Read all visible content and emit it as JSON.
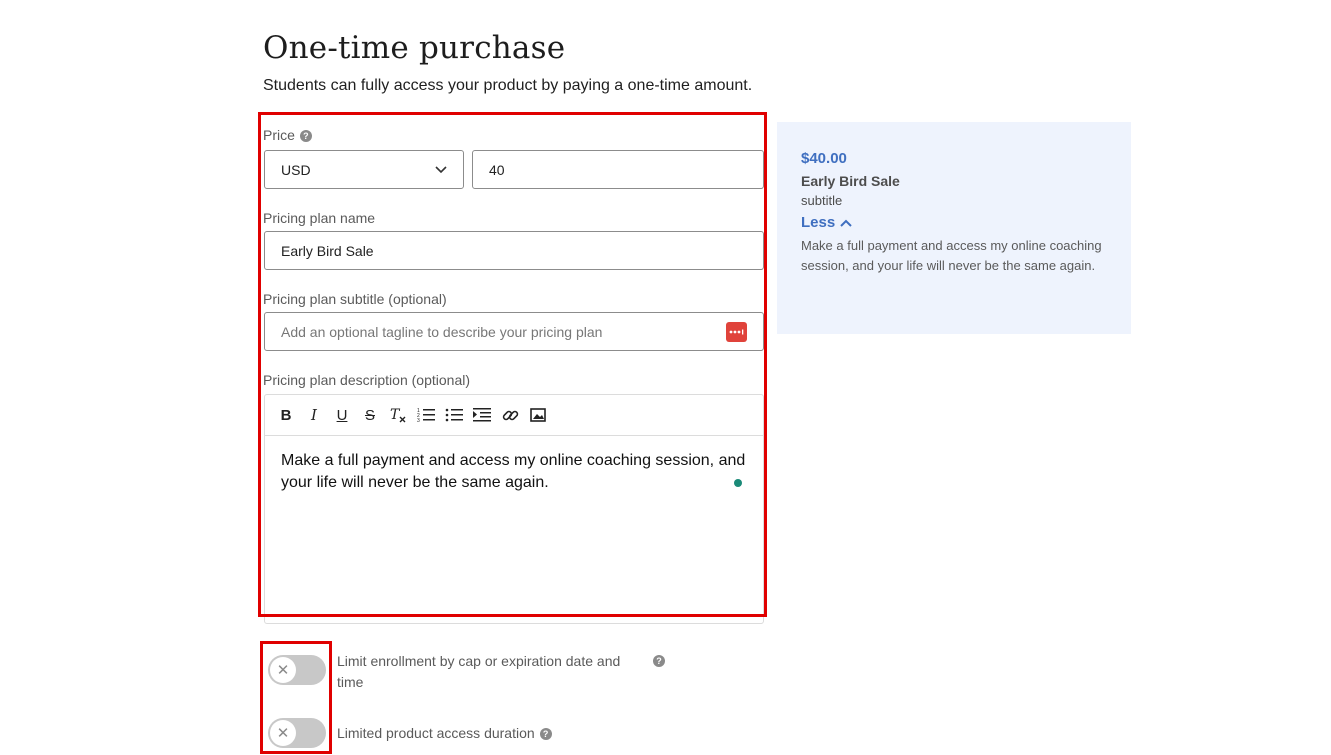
{
  "header": {
    "title": "One-time purchase",
    "description": "Students can fully access your product by paying a one-time amount."
  },
  "price": {
    "label": "Price",
    "currency": "USD",
    "amount": "40"
  },
  "plan_name": {
    "label": "Pricing plan name",
    "value": "Early Bird Sale"
  },
  "plan_subtitle": {
    "label": "Pricing plan subtitle (optional)",
    "placeholder": "Add an optional tagline to describe your pricing plan"
  },
  "plan_description": {
    "label": "Pricing plan description (optional)",
    "toolbar": [
      "bold",
      "italic",
      "underline",
      "strikethrough",
      "clear-format",
      "ordered-list",
      "bullet-list",
      "indent",
      "link",
      "image"
    ],
    "value": "Make a full payment and access my online coaching session, and your life will never be the same again."
  },
  "toggles": {
    "limit_enrollment": {
      "label_line1": "Limit enrollment by cap or expiration date and",
      "label_line2": "time",
      "on": false
    },
    "limited_access": {
      "label": "Limited product access duration",
      "on": false
    }
  },
  "preview": {
    "price": "$40.00",
    "name": "Early Bird Sale",
    "subtitle": "subtitle",
    "less_label": "Less",
    "description": "Make a full payment and access my online coaching session, and your life will never be the same again."
  },
  "colors": {
    "accent": "#3f6fc0",
    "highlight_box": "#e00000",
    "preview_bg": "#eef3fd",
    "toggle_off": "#c8c8c8"
  }
}
